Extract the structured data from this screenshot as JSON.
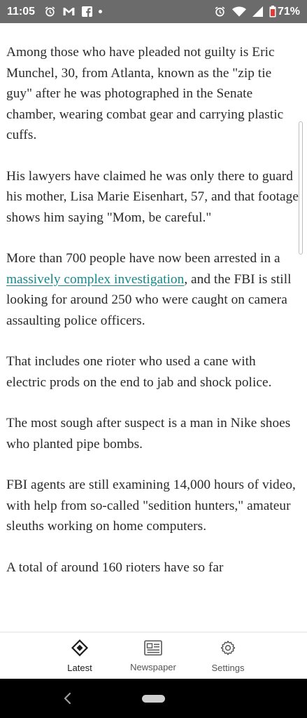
{
  "status_bar": {
    "time": "11:05",
    "battery_percent": "71%",
    "left_icons": [
      "alarm-icon",
      "gmail-icon",
      "facebook-icon",
      "dot-icon"
    ],
    "right_icons": [
      "alarm-icon",
      "wifi-icon",
      "signal-icon",
      "battery-icon"
    ]
  },
  "article": {
    "paragraphs": [
      {
        "text": "Among those who have pleaded not guilty is Eric Munchel, 30, from Atlanta, known as the \"zip tie guy\" after he was photographed in the Senate chamber, wearing combat gear and carrying plastic cuffs."
      },
      {
        "text": "His lawyers have claimed he was only there to guard his mother, Lisa Marie Eisenhart, 57, and that footage shows him saying \"Mom, be careful.\""
      },
      {
        "before": "More than 700 people have now been arrested in a ",
        "link": "massively complex investigation",
        "after": ", and the FBI is still looking for around 250 who were caught on camera assaulting police officers."
      },
      {
        "text": "That includes one rioter who used a cane with electric prods on the end to jab and shock police."
      },
      {
        "text": "The most sough after suspect is a man in Nike shoes who planted pipe bombs."
      },
      {
        "text": "FBI agents are still examining 14,000 hours of video, with help from so-called \"sedition hunters,\" amateur sleuths working on home computers."
      },
      {
        "text": "A total of around 160 rioters have so far"
      }
    ]
  },
  "bottom_nav": {
    "items": [
      {
        "label": "Latest",
        "icon": "diamond-icon",
        "active": true
      },
      {
        "label": "Newspaper",
        "icon": "newspaper-icon",
        "active": false
      },
      {
        "label": "Settings",
        "icon": "gear-icon",
        "active": false
      }
    ]
  },
  "colors": {
    "status_bar_bg": "#6b6b6b",
    "link": "#13898b",
    "body_text": "#2a2a2a",
    "battery_low_accent": "#e53935"
  }
}
